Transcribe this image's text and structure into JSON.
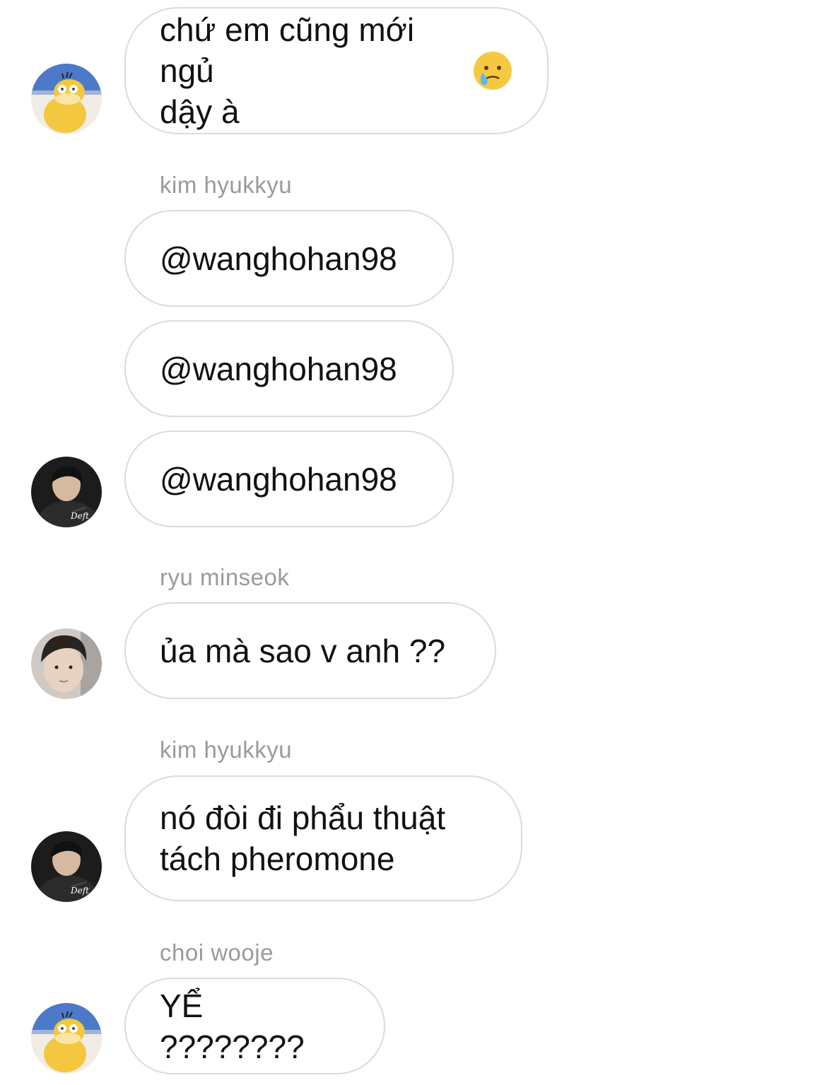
{
  "messages": [
    {
      "type": "bubble",
      "text": "chứ em cũng mới ngủ\ndậy à",
      "emoji": "crying-face-emoji"
    },
    {
      "type": "sender",
      "name": "kim hyukkyu"
    },
    {
      "type": "bubble",
      "text": "@wanghohan98"
    },
    {
      "type": "bubble",
      "text": "@wanghohan98"
    },
    {
      "type": "bubble",
      "text": "@wanghohan98"
    },
    {
      "type": "sender",
      "name": "ryu minseok"
    },
    {
      "type": "bubble",
      "text": "ủa mà sao v anh ??"
    },
    {
      "type": "sender",
      "name": "kim hyukkyu"
    },
    {
      "type": "bubble",
      "text": "nó đòi đi phẩu thuật\ntách pheromone"
    },
    {
      "type": "sender",
      "name": "choi wooje"
    },
    {
      "type": "bubble",
      "text": "YỂ ????????"
    }
  ],
  "avatars": {
    "deft_caption": "Deft"
  },
  "colors": {
    "bubble_border": "#dbdbdb",
    "sender_name": "#9a9a9a",
    "text": "#111111",
    "background": "#ffffff"
  }
}
